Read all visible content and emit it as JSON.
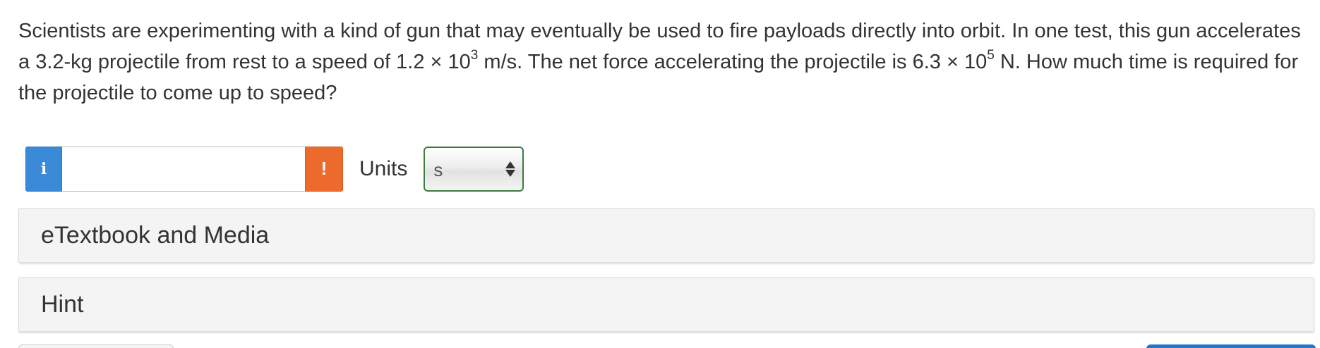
{
  "question": {
    "part1": "Scientists are experimenting with a kind of gun that may eventually be used to fire payloads directly into orbit. In one test, this gun accelerates a ",
    "mass": "3.2-kg",
    "part2": " projectile from rest to a speed of ",
    "speed_mantissa": "1.2 × 10",
    "speed_exp": "3",
    "speed_unit": " m/s",
    "part3": ". The net force accelerating the projectile is ",
    "force_mantissa": "6.3 × 10",
    "force_exp": "5",
    "force_unit": " N",
    "part4": ". How much time is required for the projectile to come up to speed?"
  },
  "answer": {
    "info_icon": "i",
    "value": "",
    "placeholder": "",
    "warning_icon": "!",
    "units_label": "Units",
    "units_selected": "s"
  },
  "panels": {
    "etextbook_label": "eTextbook and Media",
    "hint_label": "Hint"
  },
  "colors": {
    "info_blue": "#3a8ad8",
    "warning_orange": "#ec6a2c",
    "select_border_green": "#3f7a3f",
    "panel_bg": "#f4f4f4"
  }
}
